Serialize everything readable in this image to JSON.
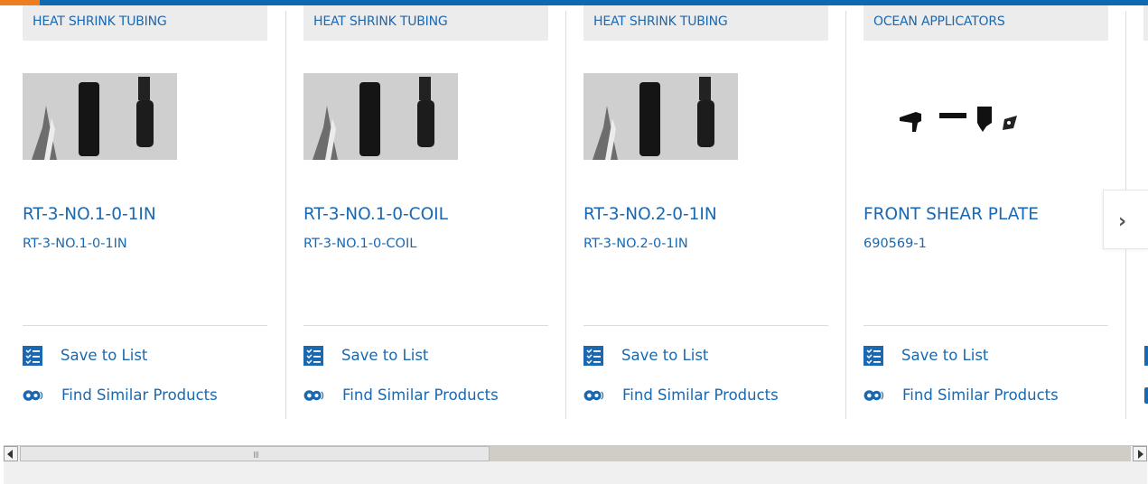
{
  "products": [
    {
      "category": "HEAT SHRINK TUBING",
      "title": "RT-3-NO.1-0-1IN",
      "part_number": "RT-3-NO.1-0-1IN",
      "save_label": "Save to List",
      "similar_label": "Find Similar Products"
    },
    {
      "category": "HEAT SHRINK TUBING",
      "title": "RT-3-NO.1-0-COIL",
      "part_number": "RT-3-NO.1-0-COIL",
      "save_label": "Save to List",
      "similar_label": "Find Similar Products"
    },
    {
      "category": "HEAT SHRINK TUBING",
      "title": "RT-3-NO.2-0-1IN",
      "part_number": "RT-3-NO.2-0-1IN",
      "save_label": "Save to List",
      "similar_label": "Find Similar Products"
    },
    {
      "category": "OCEAN APPLICATORS",
      "title": "FRONT SHEAR PLATE",
      "part_number": "690569-1",
      "save_label": "Save to List",
      "similar_label": "Find Similar Products"
    }
  ],
  "carousel": {
    "next_icon": "chevron-right-icon"
  },
  "icons": {
    "save": "checklist-icon",
    "similar": "gears-icon"
  },
  "colors": {
    "accent_blue": "#1a68b0",
    "top_bar": "#0e6ab0",
    "top_bar_accent": "#ee7d1f",
    "category_bg": "#ececec"
  }
}
